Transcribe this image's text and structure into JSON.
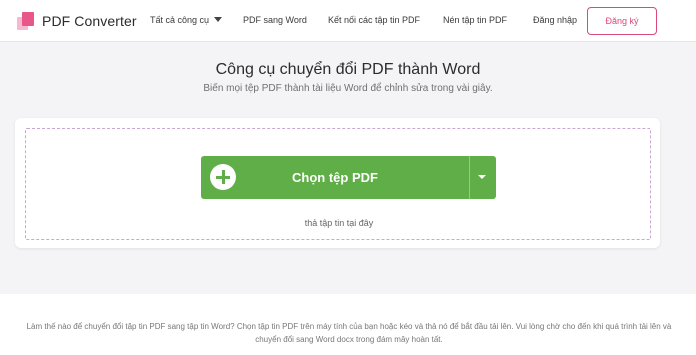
{
  "header": {
    "brand": "PDF Converter",
    "nav": [
      "Tất cả công cụ",
      "PDF sang Word",
      "Kết nối các tập tin PDF",
      "Nén tập tin PDF",
      "Đăng nhập"
    ],
    "signup_label": "Đăng ký"
  },
  "main": {
    "title": "Công cụ chuyển đổi PDF thành Word",
    "subtitle": "Biến mọi tệp PDF thành tài liệu Word để chỉnh sửa trong vài giây.",
    "upload_button": "Chọn tệp PDF",
    "drop_text": "thả tập tin tại đây"
  },
  "footer": {
    "text": "Làm thế nào để chuyển đổi tập tin PDF sang tập tin Word? Chọn tập tin PDF trên máy tính của bạn hoặc kéo và thả nó để bắt đầu tải lên. Vui lòng chờ cho đến khi quá trình tải lên và chuyển đổi sang Word docx trong đám mây hoàn tất."
  },
  "colors": {
    "accent": "#d9497a",
    "button": "#5fae47",
    "dropzone_border": "#c7a9d2"
  }
}
